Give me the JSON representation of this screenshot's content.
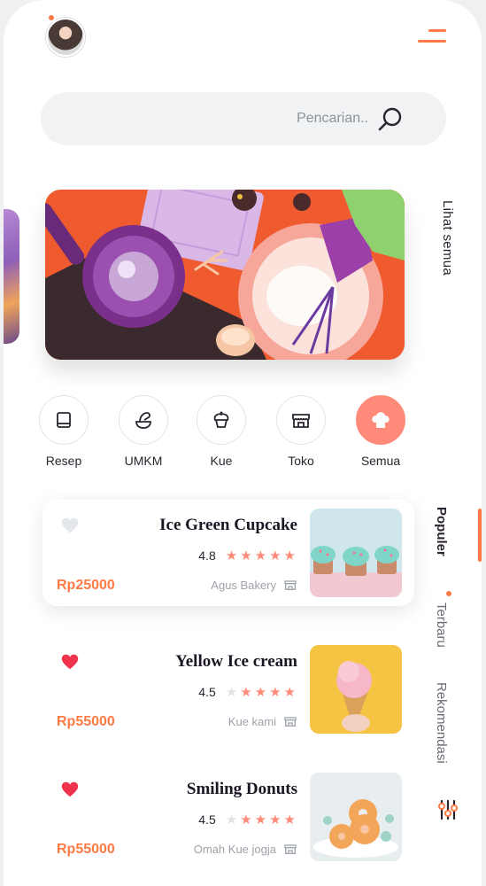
{
  "search": {
    "placeholder": "Pencarian.."
  },
  "banner": {
    "see_all": "Lihat semua"
  },
  "categories": [
    {
      "label": "Semua",
      "icon": "chef-hat-icon"
    },
    {
      "label": "Toko",
      "icon": "store-icon"
    },
    {
      "label": "Kue",
      "icon": "cupcake-icon"
    },
    {
      "label": "UMKM",
      "icon": "mixer-icon"
    },
    {
      "label": "Resep",
      "icon": "recipe-book-icon"
    }
  ],
  "tabs": [
    {
      "label": "Populer"
    },
    {
      "label": "Terbaru"
    },
    {
      "label": "Rekomendasi"
    }
  ],
  "products": [
    {
      "name": "Ice Green Cupcake",
      "rating": "4.8",
      "stars": 5,
      "shop": "Agus Bakery",
      "price": "Rp25000",
      "favorite": false
    },
    {
      "name": "Yellow Ice cream",
      "rating": "4.5",
      "stars": 4,
      "shop": "Kue kami",
      "price": "Rp55000",
      "favorite": true
    },
    {
      "name": "Smiling Donuts",
      "rating": "4.5",
      "stars": 4,
      "shop": "Omah Kue jogja",
      "price": "Rp55000",
      "favorite": true
    }
  ],
  "colors": {
    "accent": "#ff7a45",
    "accent_soft": "#ff8a7a",
    "heart": "#f0334d"
  }
}
